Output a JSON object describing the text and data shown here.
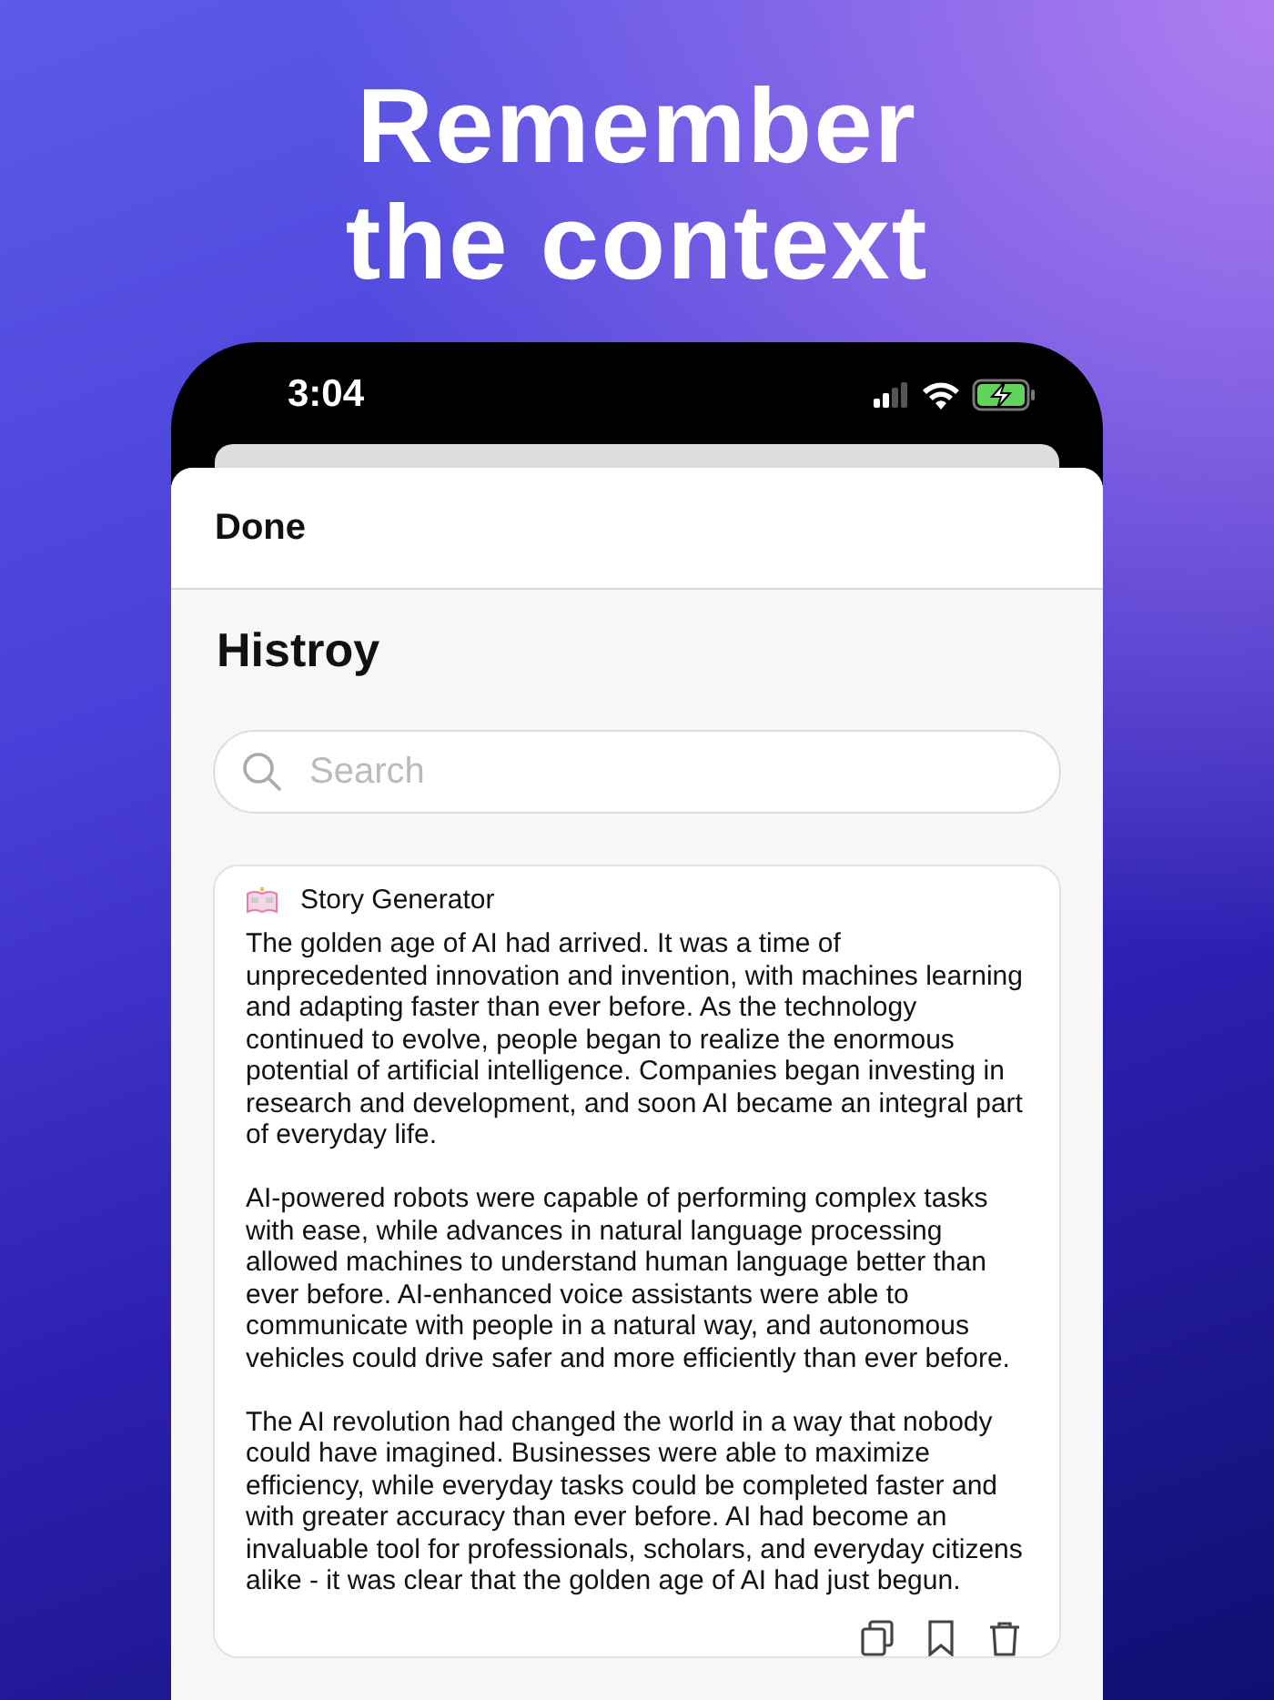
{
  "headline": [
    "Remember",
    "the context"
  ],
  "status_bar": {
    "time": "3:04"
  },
  "sheet": {
    "done_button": "Done",
    "title": "Histroy",
    "search": {
      "placeholder": "Search"
    }
  },
  "history": [
    {
      "tool": "Story Generator",
      "paragraphs": [
        "The golden age of AI had arrived. It was a time of unprecedented innovation and invention, with machines learning and adapting faster than ever before. As the technology continued to evolve, people began to realize the enormous potential of artificial intelligence. Companies began investing in research and development, and soon AI became an integral part of everyday life.",
        "AI-powered robots were capable of performing complex tasks with ease, while advances in natural language processing allowed machines to understand human language better than ever before. AI-enhanced voice assistants were able to communicate with people in a natural way, and autonomous vehicles could drive safer and more efficiently than ever before.",
        "The AI revolution had changed the world in a way that nobody could have imagined. Businesses were able to maximize efficiency, while everyday tasks could be completed faster and with greater accuracy than ever before. AI had become an invaluable tool for professionals, scholars, and everyday citizens alike - it was clear that the golden age of AI had just begun."
      ]
    }
  ]
}
